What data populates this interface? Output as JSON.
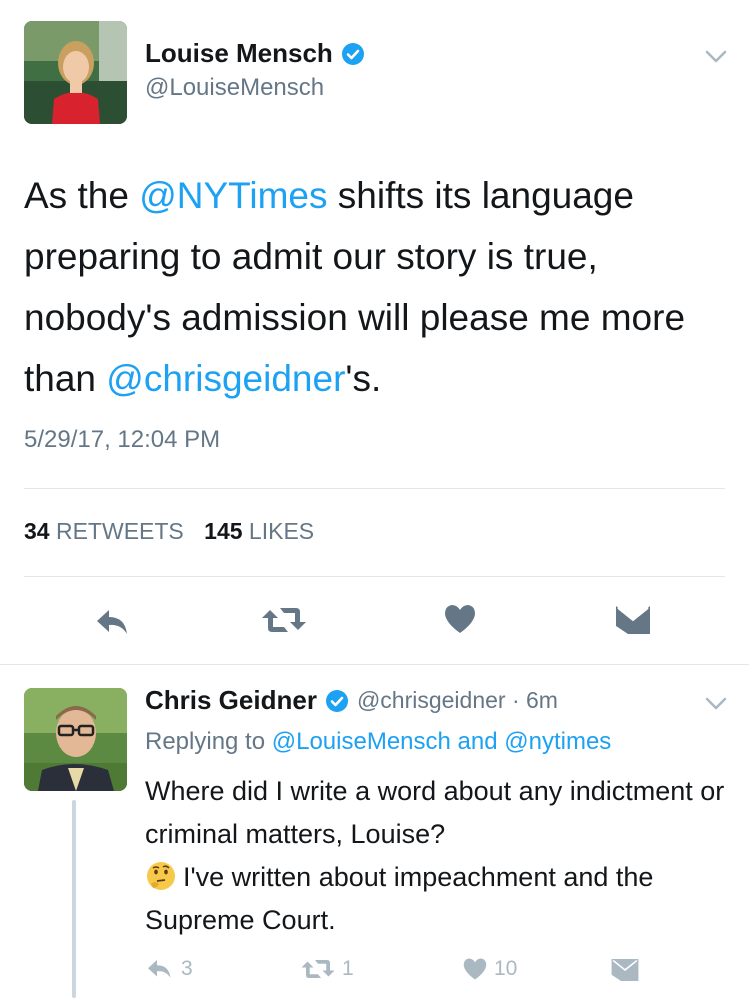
{
  "main_tweet": {
    "author_name": "Louise Mensch",
    "author_handle": "@LouiseMensch",
    "text_parts": {
      "p1": "As the ",
      "mention1": "@NYTimes",
      "p2": " shifts its language preparing to admit our story is true, nobody's admission will please me more than ",
      "mention2": "@chrisgeidner",
      "p3": "'s."
    },
    "timestamp": "5/29/17, 12:04 PM",
    "retweet_count": "34",
    "retweet_label": "RETWEETS",
    "like_count": "145",
    "like_label": "LIKES"
  },
  "reply_tweet": {
    "author_name": "Chris Geidner",
    "author_handle": "@chrisgeidner · 6m",
    "replying_to_prefix": "Replying to ",
    "replying_to_users": "@LouiseMensch and @nytimes",
    "text_line1": "Where did I write a word about any indictment or criminal matters, Louise?",
    "text_line2": "I've written about impeachment and the Supreme Court.",
    "reply_count": "3",
    "retweet_count": "1",
    "like_count": "10"
  },
  "colors": {
    "accent": "#1da1f2",
    "secondary_text": "#657786",
    "icon_gray": "#657786",
    "muted_icon": "#aab8c2",
    "divider": "#e1e8ed"
  },
  "icons": {
    "reply": "reply-icon",
    "retweet": "retweet-icon",
    "like": "heart-icon",
    "dm": "envelope-icon",
    "verified": "verified-badge-icon",
    "more": "chevron-down-icon",
    "emoji": "thinking-face-emoji"
  }
}
